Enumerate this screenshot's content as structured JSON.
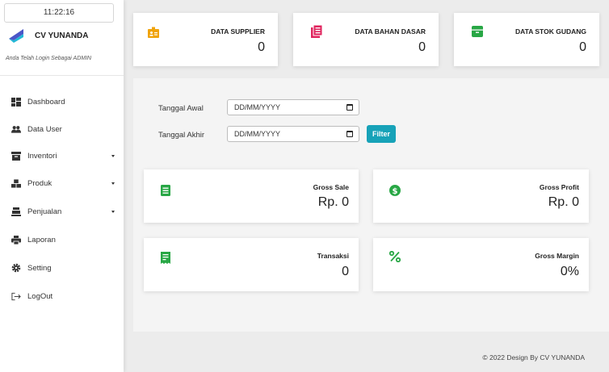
{
  "sidebar": {
    "clock": "11:22:16",
    "brand_name": "CV YUNANDA",
    "login_note": "Anda Telah Login Sebagai ADMIN",
    "items": [
      {
        "label": "Dashboard",
        "icon": "dashboard-icon",
        "has_caret": false
      },
      {
        "label": "Data User",
        "icon": "users-icon",
        "has_caret": false
      },
      {
        "label": "Inventori",
        "icon": "archive-icon",
        "has_caret": true
      },
      {
        "label": "Produk",
        "icon": "boxes-icon",
        "has_caret": true
      },
      {
        "label": "Penjualan",
        "icon": "cash-register-icon",
        "has_caret": true
      },
      {
        "label": "Laporan",
        "icon": "printer-icon",
        "has_caret": false
      },
      {
        "label": "Setting",
        "icon": "gear-icon",
        "has_caret": false
      },
      {
        "label": "LogOut",
        "icon": "logout-icon",
        "has_caret": false
      }
    ]
  },
  "top_cards": [
    {
      "title": "DATA SUPPLIER",
      "value": "0",
      "icon": "id-card-icon",
      "color": "#f0a30a"
    },
    {
      "title": "DATA BAHAN DASAR",
      "value": "0",
      "icon": "list-box-icon",
      "color": "#e0245e"
    },
    {
      "title": "DATA STOK GUDANG",
      "value": "0",
      "icon": "archive-box-icon",
      "color": "#28a745"
    }
  ],
  "filter": {
    "start_label": "Tanggal Awal",
    "end_label": "Tanggal Akhir",
    "start_placeholder": "DD/MM/YYYY",
    "end_placeholder": "DD/MM/YYYY",
    "button": "Filter",
    "button_color": "#17a2b8"
  },
  "stats": [
    {
      "title": "Gross Sale",
      "value": "Rp. 0",
      "icon": "list-icon",
      "color": "#28a745"
    },
    {
      "title": "Gross Profit",
      "value": "Rp. 0",
      "icon": "dollar-circle-icon",
      "color": "#28a745"
    },
    {
      "title": "Transaksi",
      "value": "0",
      "icon": "receipt-icon",
      "color": "#28a745"
    },
    {
      "title": "Gross Margin",
      "value": "0%",
      "icon": "percent-icon",
      "color": "#28a745"
    }
  ],
  "footer": "© 2022 Design By CV YUNANDA"
}
